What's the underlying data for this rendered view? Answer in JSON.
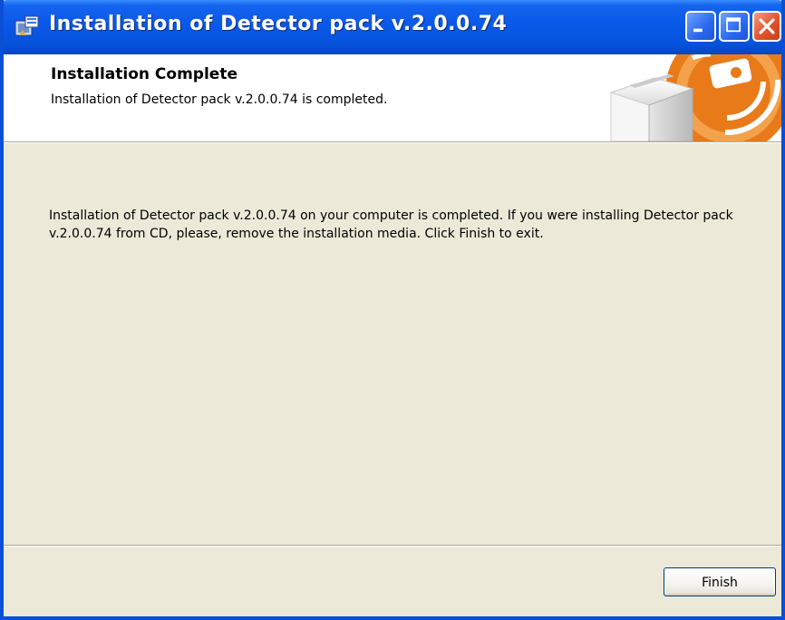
{
  "window": {
    "title": "Installation of Detector pack v.2.0.0.74",
    "controls": {
      "minimize": "minimize-icon",
      "maximize": "maximize-icon",
      "close": "close-icon"
    }
  },
  "header": {
    "title": "Installation Complete",
    "subtitle": "Installation of Detector pack v.2.0.0.74 is completed."
  },
  "body": {
    "message": "Installation of Detector pack v.2.0.0.74 on your computer is completed. If you were installing Detector pack v.2.0.0.74 from CD, please, remove the installation media. Click Finish to exit."
  },
  "buttons": {
    "finish": "Finish"
  },
  "colors": {
    "titlebar": "#0A58E8",
    "window_frame": "#0A4FD6",
    "dialog_bg": "#ECE9D8",
    "brand_orange": "#F08A24",
    "close_red": "#E2532E"
  }
}
